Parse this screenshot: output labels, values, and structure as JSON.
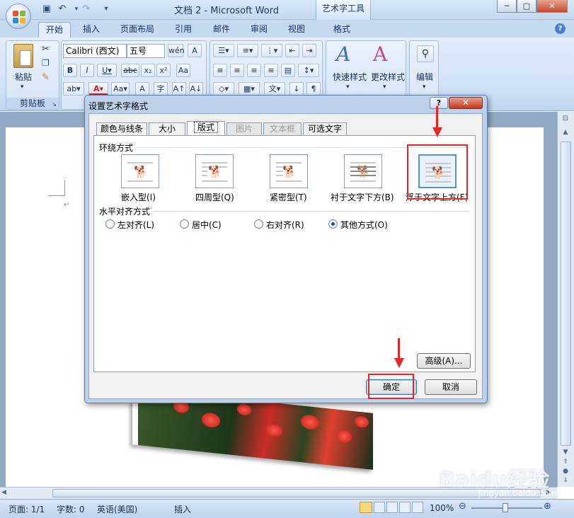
{
  "app": {
    "window_title": "文档 2 - Microsoft Word",
    "context_tab_group": "艺术字工具",
    "window_buttons": [
      "─",
      "□",
      "✕"
    ]
  },
  "ribbon": {
    "tabs": [
      "开始",
      "插入",
      "页面布局",
      "引用",
      "邮件",
      "审阅",
      "视图",
      "格式"
    ],
    "active_tab": "开始",
    "clipboard": {
      "paste_label": "粘贴",
      "group_label": "剪贴板"
    },
    "font": {
      "font_name": "Calibri (西文)",
      "font_size": "五号"
    },
    "styles": {
      "quick_styles_label": "快速样式",
      "change_styles_label": "更改样式"
    },
    "editing": {
      "label": "编辑"
    }
  },
  "dialog": {
    "title": "设置艺术字格式",
    "help_label": "?",
    "tabs": [
      {
        "label": "颜色与线条",
        "state": "normal"
      },
      {
        "label": "大小",
        "state": "normal"
      },
      {
        "label": "版式",
        "state": "active"
      },
      {
        "label": "图片",
        "state": "disabled"
      },
      {
        "label": "文本框",
        "state": "disabled"
      },
      {
        "label": "可选文字",
        "state": "normal"
      }
    ],
    "wrap_section_title": "环绕方式",
    "wrap_options": [
      {
        "label": "嵌入型(I)",
        "selected": false
      },
      {
        "label": "四周型(Q)",
        "selected": false
      },
      {
        "label": "紧密型(T)",
        "selected": false
      },
      {
        "label": "衬于文字下方(B)",
        "selected": false
      },
      {
        "label": "浮于文字上方(F)",
        "selected": true
      }
    ],
    "align_section_title": "水平对齐方式",
    "align_options": [
      {
        "label": "左对齐(L)",
        "checked": false
      },
      {
        "label": "居中(C)",
        "checked": false
      },
      {
        "label": "右对齐(R)",
        "checked": false
      },
      {
        "label": "其他方式(O)",
        "checked": true
      }
    ],
    "advanced_label": "高级(A)...",
    "ok_label": "确定",
    "cancel_label": "取消"
  },
  "statusbar": {
    "page": "页面: 1/1",
    "words": "字数: 0",
    "language": "英语(美国)",
    "mode": "插入",
    "zoom": "100%"
  },
  "watermark": {
    "text": "Baidu经验",
    "sub": "jingyan.baidu.com"
  },
  "colors": {
    "highlight": "#e3272b",
    "ribbon_blue": "#c5d9f1"
  }
}
